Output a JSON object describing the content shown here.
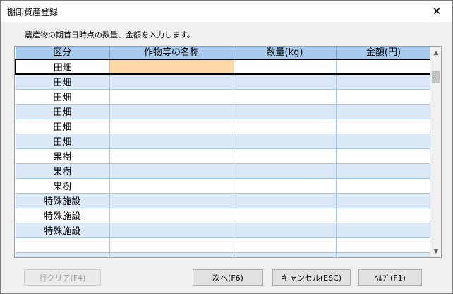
{
  "window": {
    "title": "棚卸資産登録"
  },
  "instruction": "農産物の期首日時点の数量、金額を入力します。",
  "table": {
    "headers": [
      "区分",
      "作物等の名称",
      "数量(kg)",
      "金額(円)"
    ],
    "rows": [
      [
        "田畑",
        "",
        "",
        ""
      ],
      [
        "田畑",
        "",
        "",
        ""
      ],
      [
        "田畑",
        "",
        "",
        ""
      ],
      [
        "田畑",
        "",
        "",
        ""
      ],
      [
        "田畑",
        "",
        "",
        ""
      ],
      [
        "田畑",
        "",
        "",
        ""
      ],
      [
        "果樹",
        "",
        "",
        ""
      ],
      [
        "果樹",
        "",
        "",
        ""
      ],
      [
        "果樹",
        "",
        "",
        ""
      ],
      [
        "特殊施設",
        "",
        "",
        ""
      ],
      [
        "特殊施設",
        "",
        "",
        ""
      ],
      [
        "特殊施設",
        "",
        "",
        ""
      ],
      [
        "",
        "",
        "",
        ""
      ],
      [
        "",
        "",
        "",
        ""
      ]
    ],
    "selected_row": 0,
    "active_column": 1
  },
  "buttons": {
    "clear": "行クリア(F4)",
    "next": "次へ(F6)",
    "cancel": "キャンセル(ESC)",
    "help": "ﾍﾙﾌﾟ(F1)"
  },
  "icons": {
    "close": "close-icon",
    "scroll_up": "scroll-up-icon",
    "scroll_down": "scroll-down-icon"
  },
  "colors": {
    "header_bg": "#a6cbee",
    "alt_row_bg": "#dce9f9",
    "active_cell_bg": "#fcd9a6"
  }
}
